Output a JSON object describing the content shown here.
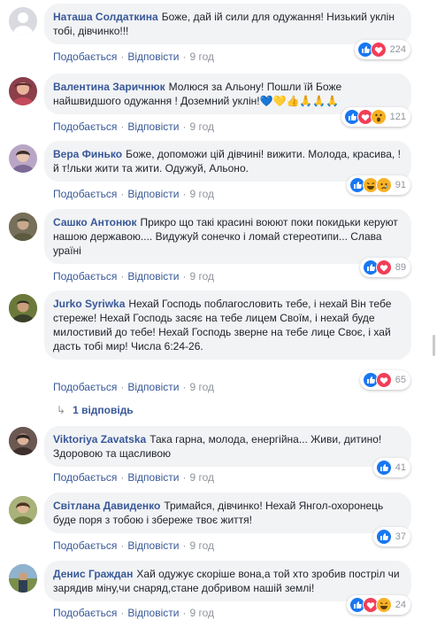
{
  "comments": [
    {
      "author": "Наташа Солдаткина",
      "text": "Боже, дай ій сили для одужання! Низький уклін тобі, дівчинко!!!",
      "reactions": [
        "like",
        "love"
      ],
      "count": "224",
      "like_label": "Подобається",
      "reply_label": "Відповісти",
      "time": "9 год",
      "avatar_color": "#d8dadf"
    },
    {
      "author": "Валентина Заричнюк",
      "text": "Молюся за Альону! Пошли їй Боже найшвидшого одужання ! Доземний уклін!💙💛👍🙏🙏🙏",
      "reactions": [
        "like",
        "love",
        "wow"
      ],
      "count": "121",
      "like_label": "Подобається",
      "reply_label": "Відповісти",
      "time": "9 год",
      "avatar_color": "#8a3f4a"
    },
    {
      "author": "Вера Финько",
      "text": "Боже, допоможи цій дівчині! вижити. Молода, красива, !й т!льки жити та жити. Одужуй, Альоно.",
      "reactions": [
        "like",
        "haha",
        "sad"
      ],
      "count": "91",
      "like_label": "Подобається",
      "reply_label": "Відповісти",
      "time": "9 год",
      "avatar_color": "#b9a6c6"
    },
    {
      "author": "Сашко Антонюк",
      "text": "Прикро що такі красині воюют поки покидьки керуют нашою державою.... Видужуй сонечко і ломай стереотипи... Слава ураїні",
      "reactions": [
        "like",
        "love"
      ],
      "count": "89",
      "like_label": "Подобається",
      "reply_label": "Відповісти",
      "time": "9 год",
      "avatar_color": "#6f6a54"
    },
    {
      "author": "Jurko Syriwka",
      "text": "Нехай Господь поблагословить тебе, і нехай Він тебе стереже! Нехай Господь засяє на тебе лицем Своїм, і нехай буде милостивий до тебе! Нехай Господь зверне на тебе лице Своє, і хай дасть тобі мир! Числа 6:24-26.",
      "reactions": [
        "like",
        "love"
      ],
      "count": "65",
      "like_label": "Подобається",
      "reply_label": "Відповісти",
      "time": "9 год",
      "avatar_color": "#4f5a2e"
    },
    {
      "author": "Viktoriya Zavatska",
      "text": "Така гарна, молода, енергійна... Живи, дитино! Здоровою та щасливою",
      "reactions": [
        "like"
      ],
      "count": "41",
      "like_label": "Подобається",
      "reply_label": "Відповісти",
      "time": "9 год",
      "avatar_color": "#5b4b46"
    },
    {
      "author": "Світлана Давиденко",
      "text": "Тримайся, дівчинко! Нехай Янгол-охоронець буде поря з тобою і збереже твоє життя!",
      "reactions": [
        "like"
      ],
      "count": "37",
      "like_label": "Подобається",
      "reply_label": "Відповісти",
      "time": "9 год",
      "avatar_color": "#9aa36b"
    },
    {
      "author": "Денис Граждан",
      "text": "Хай одужує скоріше вона,а той хто зробив пострiл чи зарядив міну,чи снаряд,стане добривом нашій землі!",
      "reactions": [
        "like",
        "love",
        "haha"
      ],
      "count": "24",
      "like_label": "Подобається",
      "reply_label": "Відповісти",
      "time": "9 год",
      "avatar_color": "#3d6d8e"
    }
  ],
  "replies_link": "1 відповідь"
}
